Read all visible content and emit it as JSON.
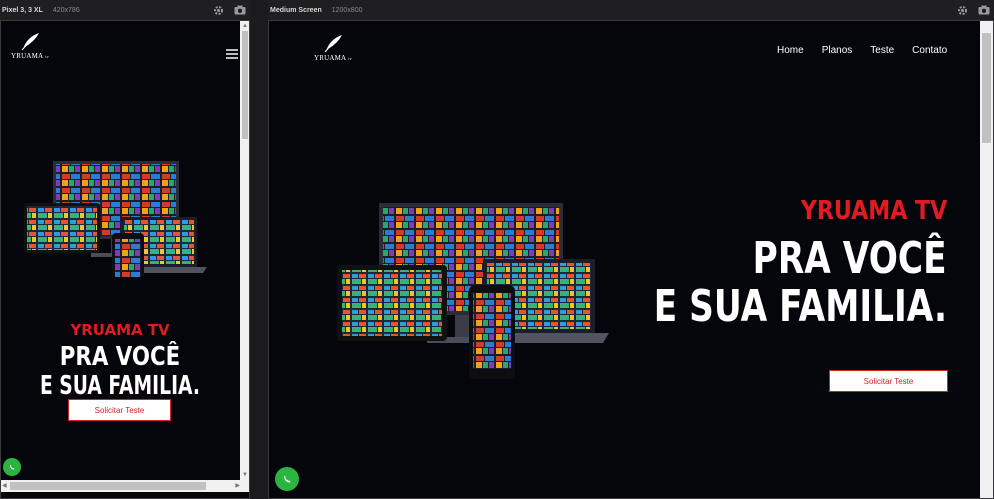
{
  "left_pane": {
    "device_name": "Pixel 3, 3 XL",
    "dimensions": "420x786",
    "site": {
      "logo_text": "YRUAMA",
      "logo_suffix": "tv",
      "heading_red": "YRUAMA TV",
      "heading_line1": "PRA VOCÊ",
      "heading_line2": "E SUA FAMILIA.",
      "cta_label": "Solicitar Teste"
    }
  },
  "right_pane": {
    "device_name": "Medium Screen",
    "dimensions": "1200x800",
    "site": {
      "logo_text": "YRUAMA",
      "logo_suffix": "tv",
      "nav": [
        "Home",
        "Planos",
        "Teste",
        "Contato"
      ],
      "heading_red": "YRUAMA TV",
      "heading_line1": "PRA VOCÊ",
      "heading_line2": "E SUA FAMILIA.",
      "cta_label": "Solicitar Teste"
    }
  },
  "colors": {
    "accent": "#e01b22",
    "background": "#05060c",
    "whatsapp": "#2bb540"
  },
  "icons": [
    "gear-icon",
    "camera-icon",
    "hamburger-icon",
    "whatsapp-icon",
    "feather-logo-icon"
  ]
}
